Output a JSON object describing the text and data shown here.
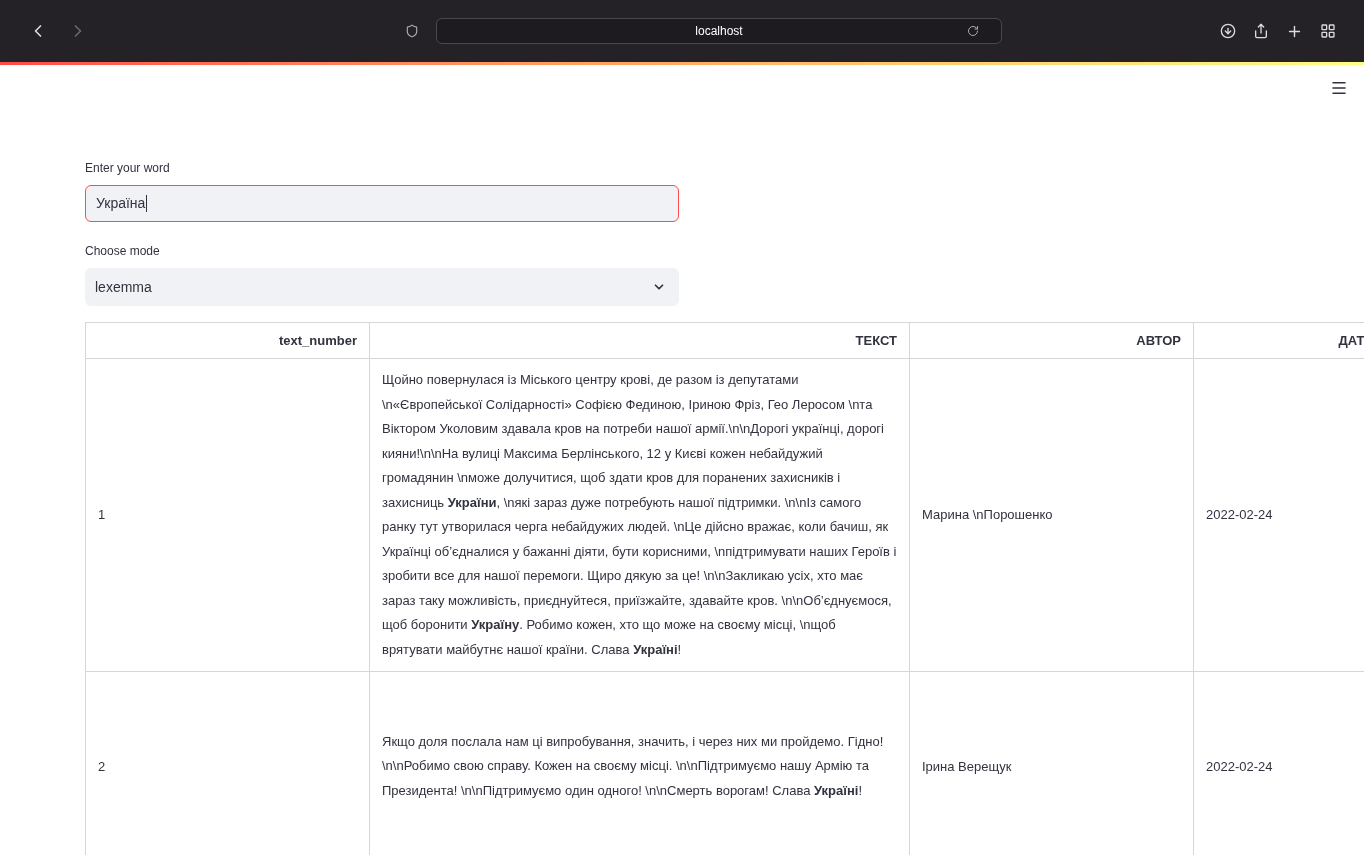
{
  "browser": {
    "address": "localhost"
  },
  "word_input": {
    "label": "Enter your word",
    "value": "Україна",
    "focused": true
  },
  "mode_select": {
    "label": "Choose mode",
    "value": "lexemma"
  },
  "table": {
    "columns": [
      "text_number",
      "ТЕКСТ",
      "АВТОР",
      "ДАТ"
    ],
    "rows": [
      {
        "cells": [
          "1",
          "Щойно повернулася із Міського центру крові, де разом із депутатами \\n«Європейської Солідарності» Софією Фединою, Іриною Фріз, Гео Леросом \\nта Віктором Уколовим здавала кров на потреби нашої армії.\\n\\nДорогі українці, дорогі кияни!\\n\\nНа вулиці Максима Берлінського, 12 у Києві кожен небайдужий громадянин \\nможе долучитися, щоб здати кров для поранених захисників і захисниць **України**, \\nякі зараз дуже потребують нашої підтримки. \\n\\nІз самого ранку тут утворилася черга небайдужих людей. \\nЦе дійсно вражає, коли бачиш, як Українці об’єдналися у бажанні діяти, бути корисними, \\nпідтримувати наших Героїв і зробити все для нашої перемоги. Щиро дякую за це! \\n\\nЗакликаю усіх, хто має зараз таку можливість, приєднуйтеся, приїзжайте, здавайте кров. \\n\\nОб’єднуємося, щоб боронити **Україну**. Робимо кожен, хто що може на своєму місці, \\nщоб врятувати майбутнє нашої країни. Слава **Україні**!",
          "Марина \\nПорошенко",
          "2022-02-24"
        ]
      },
      {
        "cells": [
          "2",
          "Якщо доля послала нам ці випробування, значить, і через них ми пройдемо. Гідно! \\n\\nРобимо свою справу. Кожен на своєму місці. \\n\\nПідтримуємо нашу Армію та Президента! \\n\\nПідтримуємо один одного! \\n\\nСмерть ворогам! Слава **Україні**!",
          "Ірина Верещук",
          "2022-02-24"
        ]
      }
    ]
  }
}
